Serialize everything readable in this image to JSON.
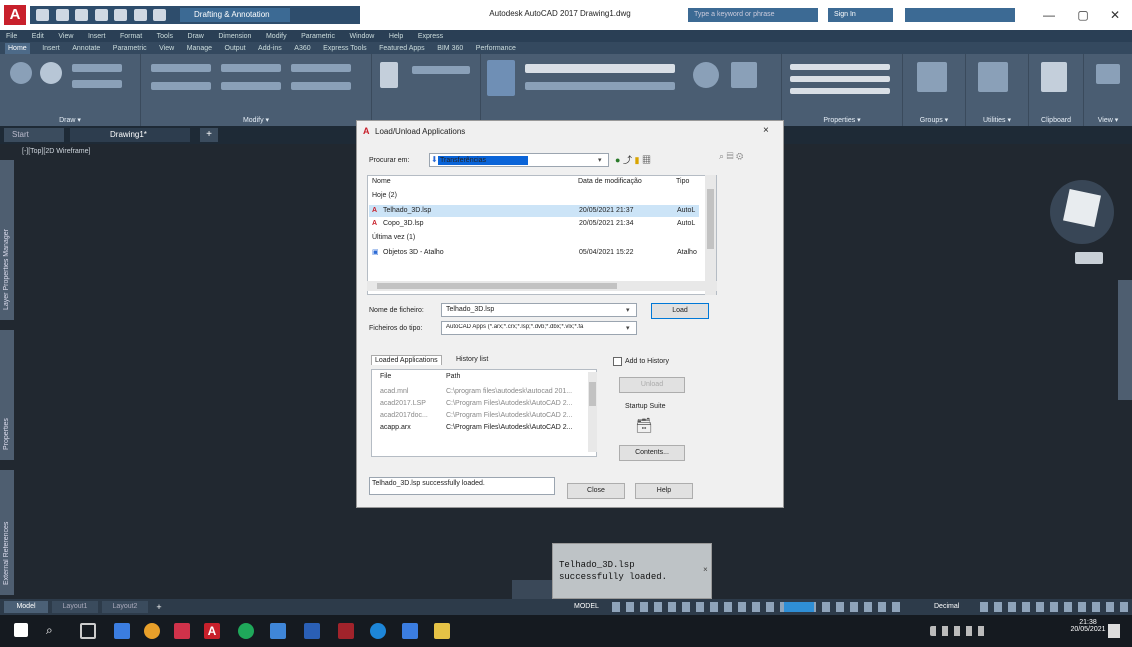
{
  "title_bar": {
    "app_logo_letter": "A",
    "workspace": "Drafting & Annotation",
    "document_title": "Autodesk AutoCAD 2017   Drawing1.dwg",
    "search_placeholder": "Type a keyword or phrase",
    "signin": "Sign In",
    "minimize": "—",
    "maximize": "▢",
    "close": "✕"
  },
  "menu_bar": [
    "File",
    "Edit",
    "View",
    "Insert",
    "Format",
    "Tools",
    "Draw",
    "Dimension",
    "Modify",
    "Parametric",
    "Window",
    "Help",
    "Express"
  ],
  "ribbon_tabs": [
    "Home",
    "Insert",
    "Annotate",
    "Parametric",
    "View",
    "Manage",
    "Output",
    "Add-ins",
    "A360",
    "Express Tools",
    "Featured Apps",
    "BIM 360",
    "Performance"
  ],
  "ribbon_panels": {
    "draw": "Draw ▾",
    "modify": "Modify ▾",
    "properties": "Properties ▾",
    "groups": "Groups ▾",
    "utilities": "Utilities ▾",
    "clipboard": "Clipboard",
    "view": "View ▾"
  },
  "file_tabs": {
    "start": "Start",
    "drawing": "Drawing1*",
    "add": "+"
  },
  "viewport_label": "[-][Top][2D Wireframe]",
  "palettes": {
    "left_top": "Layer Properties Manager",
    "left_mid": "Properties",
    "left_bottom": "External References"
  },
  "dialog": {
    "title": "Load/Unload Applications",
    "close": "×",
    "look_in_label": "Procurar em:",
    "look_in_value": "Transferências",
    "columns": {
      "name": "Nome",
      "date": "Data de modificação",
      "type": "Tipo"
    },
    "groups": {
      "today": "Hoje (2)",
      "last_week": "Última vez (1)"
    },
    "files": [
      {
        "name": "Telhado_3D.lsp",
        "date": "20/05/2021 21:37",
        "type": "AutoL",
        "selected": true
      },
      {
        "name": "Copo_3D.lsp",
        "date": "20/05/2021 21:34",
        "type": "AutoL",
        "selected": false
      },
      {
        "name": "Objetos 3D - Atalho",
        "date": "05/04/2021 15:22",
        "type": "Atalho",
        "selected": false
      }
    ],
    "file_name_label": "Nome de ficheiro:",
    "file_name_value": "Telhado_3D.lsp",
    "file_type_label": "Ficheiros do tipo:",
    "file_type_value": "AutoCAD Apps (*.arx;*.crx;*.lsp;*.dvb;*.dbx;*.vlx;*.fa",
    "load_button": "Load",
    "loaded_apps_tab": "Loaded Applications",
    "history_tab": "History list",
    "add_history_label": "Add to History",
    "loaded_columns": {
      "file": "File",
      "path": "Path"
    },
    "loaded": [
      {
        "file": "acad.mnl",
        "path": "C:\\program files\\autodesk\\autocad 201..."
      },
      {
        "file": "acad2017.LSP",
        "path": "C:\\Program Files\\Autodesk\\AutoCAD 2..."
      },
      {
        "file": "acad2017doc...",
        "path": "C:\\Program Files\\Autodesk\\AutoCAD 2..."
      },
      {
        "file": "acapp.arx",
        "path": "C:\\Program Files\\Autodesk\\AutoCAD 2..."
      }
    ],
    "unload_button": "Unload",
    "startup_suite_label": "Startup Suite",
    "contents_button": "Contents...",
    "status_text": "Telhado_3D.lsp successfully loaded.",
    "close_button": "Close",
    "help_button": "Help"
  },
  "notification": {
    "line1": "Telhado_3D.lsp",
    "line2": "successfully loaded."
  },
  "status_bar": {
    "model": "MODEL",
    "layout_model": "Model",
    "layout1": "Layout1",
    "layout2": "Layout2",
    "add": "+",
    "units": "Decimal"
  },
  "taskbar": {
    "time": "21:38",
    "date": "20/05/2021"
  }
}
